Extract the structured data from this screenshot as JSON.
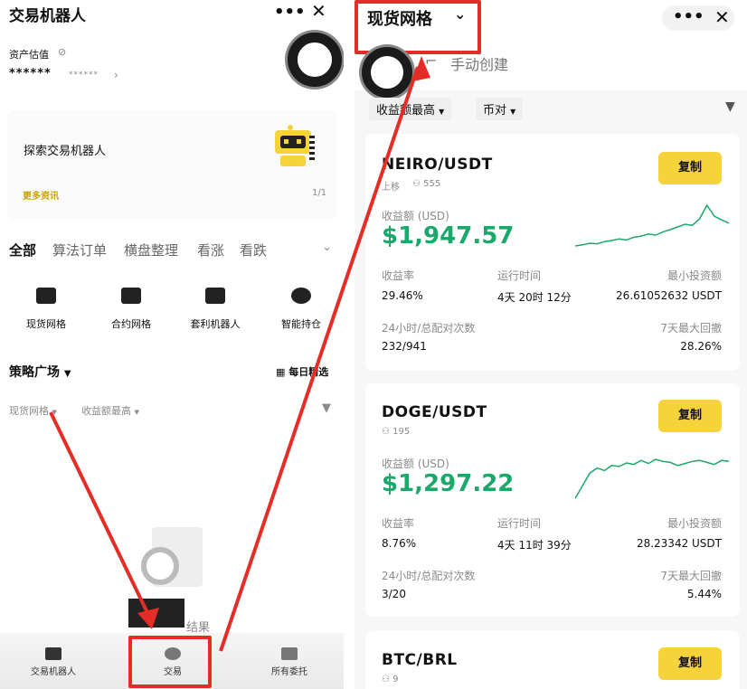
{
  "left": {
    "title": "交易机器人",
    "asset_label": "资产估值",
    "asset_masked": "******",
    "asset_masked_sub": "******",
    "asset_chevron": "›",
    "explore_text": "探索交易机器人",
    "more_info": "更多资讯",
    "pager": "1/1",
    "tabs": [
      "全部",
      "算法订单",
      "横盘整理",
      "看涨",
      "看跌"
    ],
    "features": [
      "现货网格",
      "合约网格",
      "套利机器人",
      "智能持仓"
    ],
    "strategy_title": "策略广场",
    "daily_pick": "每日精选",
    "filter1": "现货网格",
    "filter2": "收益额最高",
    "empty_text": "结果",
    "bottom_nav": [
      "交易机器人",
      "交易",
      "所有委托"
    ]
  },
  "right": {
    "title": "现货网格",
    "manual_create": "手动创建",
    "sort_label": "收益额最高",
    "pair_filter": "币对",
    "cards": [
      {
        "pair": "NEIRO/USDT",
        "sub": "上移",
        "users": "555",
        "copy": "复制",
        "profit_label": "收益额 (USD)",
        "profit": "$1,947.57",
        "rate_label": "收益率",
        "rate": "29.46%",
        "runtime_label": "运行时间",
        "runtime": "4天 20时 12分",
        "min_label": "最小投资额",
        "min": "26.61052632 USDT",
        "trades_label": "24小时/总配对次数",
        "trades": "232/941",
        "dd_label": "7天最大回撤",
        "dd": "28.26%",
        "spark": [
          0.2,
          0.22,
          0.25,
          0.24,
          0.28,
          0.3,
          0.33,
          0.31,
          0.36,
          0.38,
          0.42,
          0.4,
          0.46,
          0.5,
          0.55,
          0.6,
          0.58,
          0.7,
          0.95,
          0.75,
          0.68,
          0.62
        ]
      },
      {
        "pair": "DOGE/USDT",
        "sub": "",
        "users": "195",
        "copy": "复制",
        "profit_label": "收益额 (USD)",
        "profit": "$1,297.22",
        "rate_label": "收益率",
        "rate": "8.76%",
        "runtime_label": "运行时间",
        "runtime": "4天 11时 39分",
        "min_label": "最小投资额",
        "min": "28.23342 USDT",
        "trades_label": "24小时/总配对次数",
        "trades": "3/20",
        "dd_label": "7天最大回撤",
        "dd": "5.44%",
        "spark": [
          0.05,
          0.3,
          0.55,
          0.65,
          0.6,
          0.7,
          0.68,
          0.75,
          0.72,
          0.8,
          0.74,
          0.82,
          0.78,
          0.76,
          0.7,
          0.74,
          0.78,
          0.8,
          0.76,
          0.72,
          0.8,
          0.78
        ]
      },
      {
        "pair": "BTC/BRL",
        "users": "9",
        "copy": "复制"
      }
    ]
  },
  "colors": {
    "accent": "#f6d33b",
    "profit": "#1aa86b",
    "annotation": "#e52d27"
  }
}
